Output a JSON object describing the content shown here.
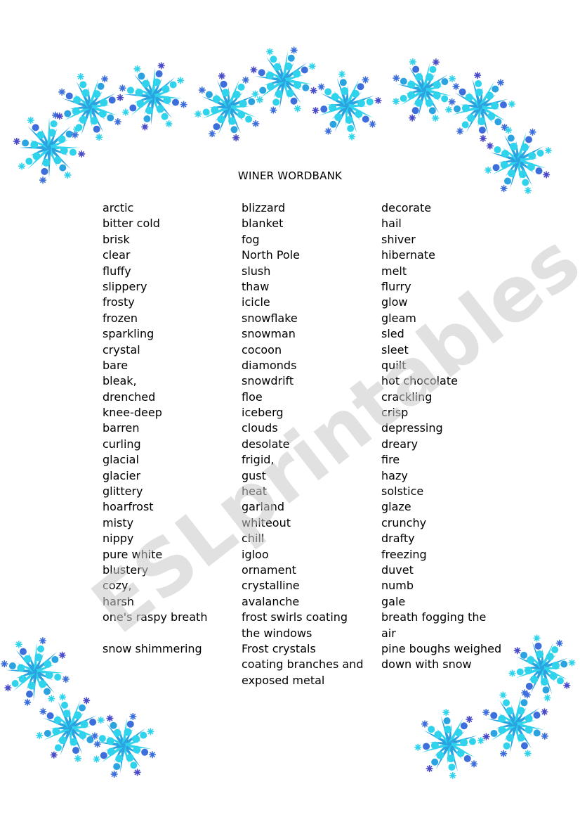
{
  "title": "WINER WORDBANK",
  "watermark": "ESLprintables.com",
  "colors": {
    "snowflake_light": "#2fd3ec",
    "snowflake_mid": "#2aa3e0",
    "snowflake_dark": "#3d6fdc",
    "snowflake_violet": "#4a4bc8",
    "watermark": "#c8c8c8",
    "text": "#000000"
  },
  "columns": [
    {
      "words": [
        "arctic",
        "bitter cold",
        "brisk",
        "clear",
        "fluffy",
        "slippery",
        "frosty",
        "frozen",
        "sparkling",
        "crystal",
        "bare",
        "bleak,",
        "drenched",
        "knee-deep",
        "barren",
        "curling",
        "glacial",
        "glacier",
        "glittery",
        "hoarfrost",
        "misty",
        "nippy",
        "pure white",
        "blustery",
        "cozy,",
        "harsh",
        "one's raspy breath",
        "",
        "snow shimmering"
      ]
    },
    {
      "words": [
        "blizzard",
        "blanket",
        "fog",
        "North Pole",
        "slush",
        "thaw",
        "icicle",
        "snowflake",
        "snowman",
        "cocoon",
        "diamonds",
        "snowdrift",
        "floe",
        "iceberg",
        "clouds",
        "desolate",
        "frigid,",
        "gust",
        "heat",
        "garland",
        "whiteout",
        "chill",
        "igloo",
        "ornament",
        "crystalline",
        "avalanche",
        "frost swirls coating",
        "the windows",
        "Frost crystals",
        "coating branches and",
        "exposed metal"
      ]
    },
    {
      "words": [
        "decorate",
        "hail",
        "shiver",
        "hibernate",
        "melt",
        "flurry",
        "glow",
        "gleam",
        "sled",
        "sleet",
        "quilt",
        "hot chocolate",
        "crackling",
        "crisp",
        "depressing",
        "dreary",
        "fire",
        "hazy",
        "solstice",
        "glaze",
        "crunchy",
        "drafty",
        "freezing",
        "duvet",
        "numb",
        "gale",
        "breath fogging the",
        "air",
        "pine boughs weighed",
        "down with snow"
      ]
    }
  ]
}
